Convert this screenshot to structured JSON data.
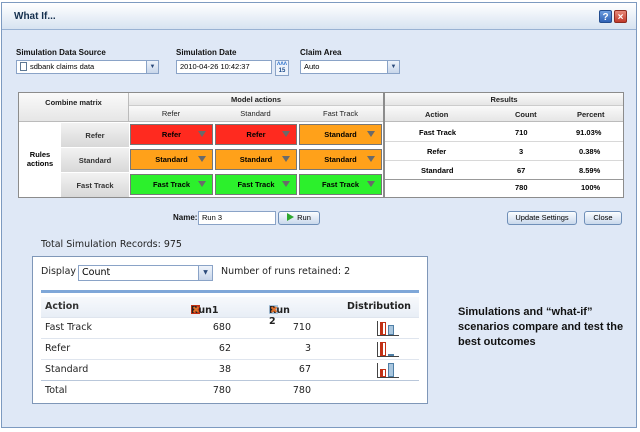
{
  "window": {
    "title": "What If..."
  },
  "sim": {
    "source_label": "Simulation Data Source",
    "source_value": "sdbank claims data",
    "date_label": "Simulation Date",
    "date_value": "2010-04-26 10:42:37",
    "cal_day": "15",
    "area_label": "Claim Area",
    "area_value": "Auto"
  },
  "matrix": {
    "combine_label": "Combine matrix",
    "model_actions_label": "Model actions",
    "rules_actions_label": "Rules actions",
    "columns": [
      "Refer",
      "Standard",
      "Fast Track"
    ],
    "rows": [
      {
        "label": "Refer",
        "cells": [
          "Refer",
          "Refer",
          "Standard"
        ]
      },
      {
        "label": "Standard",
        "cells": [
          "Standard",
          "Standard",
          "Standard"
        ]
      },
      {
        "label": "Fast Track",
        "cells": [
          "Fast Track",
          "Fast Track",
          "Fast Track"
        ]
      }
    ]
  },
  "results": {
    "title": "Results",
    "headers": [
      "Action",
      "Count",
      "Percent"
    ],
    "rows": [
      [
        "Fast Track",
        "710",
        "91.03%"
      ],
      [
        "Refer",
        "3",
        "0.38%"
      ],
      [
        "Standard",
        "67",
        "8.59%"
      ]
    ],
    "total": [
      "",
      "780",
      "100%"
    ]
  },
  "run": {
    "name_label": "Name:",
    "name_value": "Run 3",
    "run_button": "Run",
    "update_button": "Update Settings",
    "close_button": "Close"
  },
  "summary": {
    "total_records": "Total Simulation Records: 975",
    "display_label": "Display",
    "display_value": "Count",
    "runs_retained": "Number of runs retained: 2",
    "headers": [
      "Action",
      "Run1",
      "Run 2",
      "Distribution"
    ],
    "rows": [
      {
        "action": "Fast Track",
        "run1": "680",
        "run2": "710",
        "dist": [
          0.96,
          0.74
        ]
      },
      {
        "action": "Refer",
        "run1": "62",
        "run2": "3",
        "dist": [
          1.0,
          0.05
        ]
      },
      {
        "action": "Standard",
        "run1": "38",
        "run2": "67",
        "dist": [
          0.57,
          1.0
        ]
      }
    ],
    "total": {
      "action": "Total",
      "run1": "780",
      "run2": "780"
    }
  },
  "colors": {
    "run1": "#c23014",
    "run2": "#a9c6de",
    "refer": "#ff2a1f",
    "standard": "#ffa11a",
    "fast_track": "#2cf02c"
  },
  "caption": "Simulations and “what-if” scenarios compare and test the best outcomes"
}
